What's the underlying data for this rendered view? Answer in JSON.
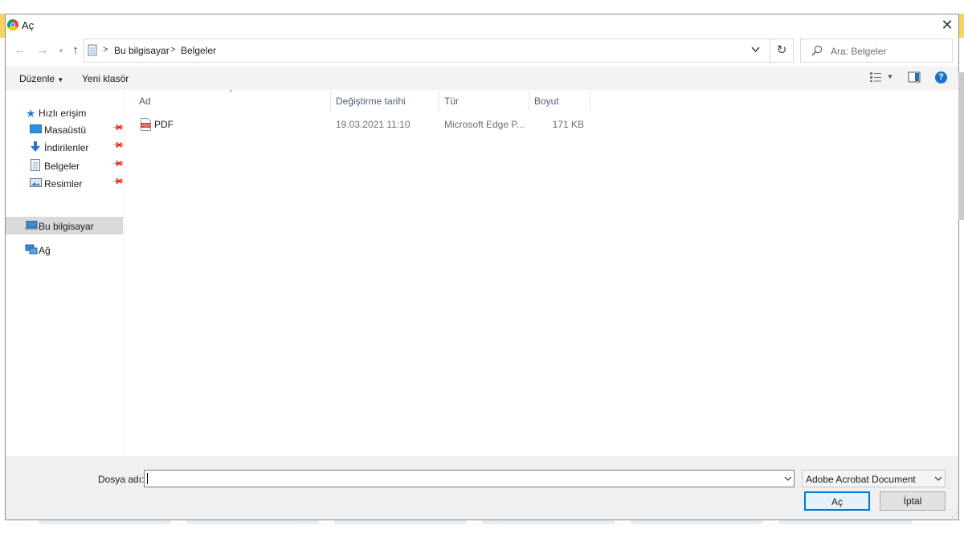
{
  "window": {
    "title": "Aç"
  },
  "address": {
    "crumbs": [
      "Bu bilgisayar",
      "Belgeler"
    ]
  },
  "search": {
    "placeholder": "Ara: Belgeler"
  },
  "toolbar": {
    "organize": "Düzenle",
    "new_folder": "Yeni klasör"
  },
  "sidebar": {
    "quick_access": "Hızlı erişim",
    "items": [
      {
        "label": "Masaüstü",
        "icon": "desktop-icon"
      },
      {
        "label": "İndirilenler",
        "icon": "downloads-icon"
      },
      {
        "label": "Belgeler",
        "icon": "documents-icon"
      },
      {
        "label": "Resimler",
        "icon": "pictures-icon"
      }
    ],
    "this_pc": "Bu bilgisayar",
    "network": "Ağ"
  },
  "columns": {
    "name": "Ad",
    "date": "Değiştirme tarihi",
    "type": "Tür",
    "size": "Boyut"
  },
  "files": [
    {
      "name": "PDF",
      "date": "19.03.2021 11:10",
      "type": "Microsoft Edge P...",
      "size": "171 KB",
      "icon": "pdf-file-icon"
    }
  ],
  "bottom": {
    "filename_label": "Dosya adı:",
    "filename_value": "",
    "filetype_selected": "Adobe Acrobat Document",
    "open": "Aç",
    "cancel": "İptal"
  },
  "colors": {
    "accent": "#0078d7",
    "selection": "#d9d9d9",
    "button_border": "#0078d7",
    "help": "#1a6fc9"
  }
}
